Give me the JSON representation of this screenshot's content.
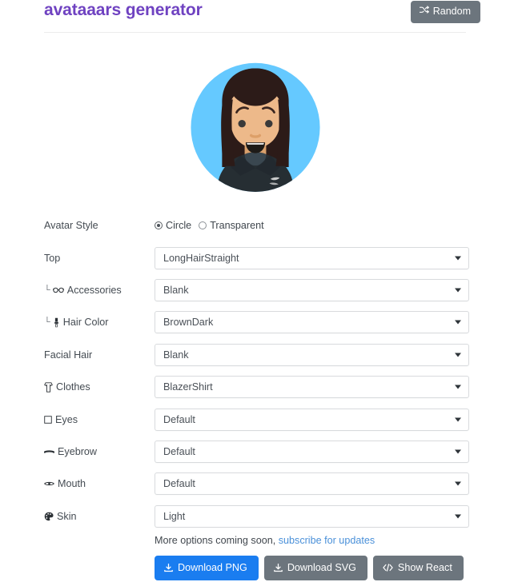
{
  "header": {
    "title": "avataaars generator",
    "random_label": "Random",
    "random_icon": "shuffle-icon"
  },
  "avatar": {
    "style": "Circle",
    "background_color": "#65C9FF",
    "skin_color": "#EDB98A",
    "hair_color": "#2C1B18",
    "clothes_color": "#262E33",
    "description": "LongHairStraight, BrownDark hair, Light skin, BlazerShirt, Default eyes, Default eyebrow, Default mouth"
  },
  "form": {
    "avatar_style": {
      "label": "Avatar Style",
      "options": [
        "Circle",
        "Transparent"
      ],
      "selected": "Circle"
    },
    "rows": [
      {
        "label": "Top",
        "icon": "",
        "sub": false,
        "value": "LongHairStraight"
      },
      {
        "label": "Accessories",
        "icon": "glasses-icon",
        "sub": true,
        "value": "Blank"
      },
      {
        "label": "Hair Color",
        "icon": "paintbrush-icon",
        "sub": true,
        "value": "BrownDark"
      },
      {
        "label": "Facial Hair",
        "icon": "",
        "sub": false,
        "value": "Blank"
      },
      {
        "label": "Clothes",
        "icon": "tshirt-icon",
        "sub": false,
        "value": "BlazerShirt"
      },
      {
        "label": "Eyes",
        "icon": "eye-icon",
        "sub": false,
        "value": "Default"
      },
      {
        "label": "Eyebrow",
        "icon": "eyebrow-icon",
        "sub": false,
        "value": "Default"
      },
      {
        "label": "Mouth",
        "icon": "mouth-icon",
        "sub": false,
        "value": "Default"
      },
      {
        "label": "Skin",
        "icon": "palette-icon",
        "sub": false,
        "value": "Light"
      }
    ]
  },
  "footer": {
    "note_text": "More options coming soon,",
    "note_link": "subscribe for updates",
    "buttons": [
      {
        "label": "Download PNG",
        "icon": "download-icon",
        "style": "primary"
      },
      {
        "label": "Download SVG",
        "icon": "download-icon",
        "style": "secondary"
      },
      {
        "label": "Show React",
        "icon": "code-icon",
        "style": "secondary"
      }
    ]
  },
  "colors": {
    "brand_purple": "#6f42c1",
    "link_blue": "#4a90d9",
    "primary_blue": "#1a7df0",
    "secondary_gray": "#6c757d"
  }
}
